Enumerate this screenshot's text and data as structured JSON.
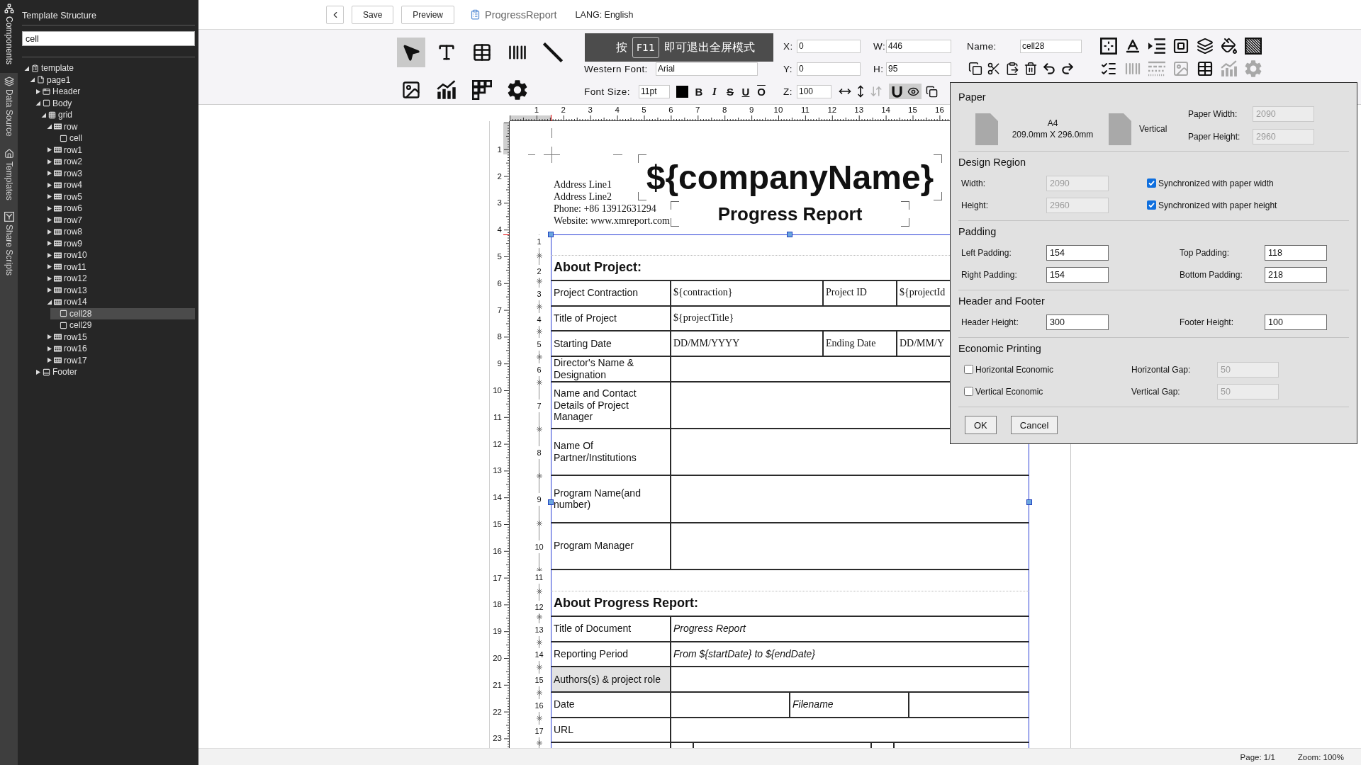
{
  "side_tabs": [
    {
      "label": "Components",
      "kind": "components",
      "selected": true
    },
    {
      "label": "Data Source",
      "kind": "datasource",
      "selected": false
    },
    {
      "label": "Templates",
      "kind": "templates",
      "selected": false
    },
    {
      "label": "Share Scripts",
      "kind": "scripts",
      "selected": false
    }
  ],
  "structure_panel": {
    "title": "Template Structure",
    "search": {
      "value": "cell"
    },
    "tree": [
      {
        "label": "template",
        "kind": "template",
        "expanded": true,
        "selected": false,
        "children": [
          {
            "label": "page1",
            "kind": "page",
            "expanded": true,
            "selected": false,
            "children": [
              {
                "label": "Header",
                "kind": "header",
                "expanded": false,
                "selected": false
              },
              {
                "label": "Body",
                "kind": "body",
                "expanded": true,
                "selected": false,
                "children": [
                  {
                    "label": "grid",
                    "kind": "grid",
                    "expanded": true,
                    "selected": false,
                    "children": [
                      {
                        "label": "row",
                        "kind": "row",
                        "expanded": true,
                        "selected": false,
                        "children": [
                          {
                            "label": "cell",
                            "kind": "cell",
                            "selected": false
                          }
                        ]
                      },
                      {
                        "label": "row1",
                        "kind": "row",
                        "expanded": false,
                        "selected": false
                      },
                      {
                        "label": "row2",
                        "kind": "row",
                        "expanded": false,
                        "selected": false
                      },
                      {
                        "label": "row3",
                        "kind": "row",
                        "expanded": false,
                        "selected": false
                      },
                      {
                        "label": "row4",
                        "kind": "row",
                        "expanded": false,
                        "selected": false
                      },
                      {
                        "label": "row5",
                        "kind": "row",
                        "expanded": false,
                        "selected": false
                      },
                      {
                        "label": "row6",
                        "kind": "row",
                        "expanded": false,
                        "selected": false
                      },
                      {
                        "label": "row7",
                        "kind": "row",
                        "expanded": false,
                        "selected": false
                      },
                      {
                        "label": "row8",
                        "kind": "row",
                        "expanded": false,
                        "selected": false
                      },
                      {
                        "label": "row9",
                        "kind": "row",
                        "expanded": false,
                        "selected": false
                      },
                      {
                        "label": "row10",
                        "kind": "row",
                        "expanded": false,
                        "selected": false
                      },
                      {
                        "label": "row11",
                        "kind": "row",
                        "expanded": false,
                        "selected": false
                      },
                      {
                        "label": "row12",
                        "kind": "row",
                        "expanded": false,
                        "selected": false
                      },
                      {
                        "label": "row13",
                        "kind": "row",
                        "expanded": false,
                        "selected": false
                      },
                      {
                        "label": "row14",
                        "kind": "row",
                        "expanded": true,
                        "selected": false,
                        "children": [
                          {
                            "label": "cell28",
                            "kind": "cell",
                            "selected": true
                          },
                          {
                            "label": "cell29",
                            "kind": "cell",
                            "selected": false
                          }
                        ]
                      },
                      {
                        "label": "row15",
                        "kind": "row",
                        "expanded": false,
                        "selected": false
                      },
                      {
                        "label": "row16",
                        "kind": "row",
                        "expanded": false,
                        "selected": false
                      },
                      {
                        "label": "row17",
                        "kind": "row",
                        "expanded": false,
                        "selected": false
                      }
                    ]
                  }
                ]
              },
              {
                "label": "Footer",
                "kind": "footer",
                "expanded": false,
                "selected": false
              }
            ]
          }
        ]
      }
    ]
  },
  "top_bar": {
    "buttons": [
      "Save",
      "Preview"
    ],
    "document_name": "ProgressReport",
    "language": "LANG: English"
  },
  "toolbar": {
    "tools": [
      {
        "kind": "pointer",
        "selected": true
      },
      {
        "kind": "text",
        "selected": false
      },
      {
        "kind": "table",
        "selected": false
      },
      {
        "kind": "barcode",
        "selected": false
      },
      {
        "kind": "line",
        "selected": false
      },
      {
        "kind": "image",
        "selected": false
      },
      {
        "kind": "chart",
        "selected": false
      },
      {
        "kind": "crosstab",
        "selected": false
      },
      {
        "kind": "settings",
        "selected": false
      }
    ],
    "western_font": {
      "label": "Western Font:",
      "value": "Arial"
    },
    "font_size": {
      "label": "Font Size:",
      "value": "11pt"
    },
    "format_buttons": [
      {
        "label": "B",
        "kind": "bold"
      },
      {
        "label": "I",
        "kind": "italic"
      },
      {
        "label": "S",
        "kind": "strike"
      },
      {
        "label": "U",
        "kind": "underline"
      },
      {
        "label": "O",
        "kind": "overline"
      }
    ],
    "position": [
      {
        "label": "X:",
        "value": "0"
      },
      {
        "label": "W:",
        "value": "446"
      },
      {
        "label": "Y:",
        "value": "0"
      },
      {
        "label": "H:",
        "value": "95"
      }
    ],
    "z_order": {
      "label": "Z:",
      "value": "100"
    },
    "arrange_tools": [
      {
        "kind": "horizontal",
        "disabled": false
      },
      {
        "kind": "vertical",
        "disabled": false
      },
      {
        "kind": "updown",
        "disabled": true
      }
    ],
    "toggles": [
      {
        "kind": "magnet",
        "on": true
      },
      {
        "kind": "eye",
        "on": true
      }
    ],
    "name_field": {
      "label": "Name:",
      "value": "cell28"
    },
    "style_tools": [
      {
        "kind": "border",
        "disabled": false
      },
      {
        "kind": "font",
        "disabled": false
      },
      {
        "kind": "indent",
        "disabled": false
      },
      {
        "kind": "frame",
        "disabled": false
      },
      {
        "kind": "layers",
        "disabled": false
      },
      {
        "kind": "fill",
        "disabled": false
      },
      {
        "kind": "hatch",
        "disabled": false
      },
      {
        "kind": "checklist",
        "disabled": false
      },
      {
        "kind": "barcode",
        "disabled": true
      },
      {
        "kind": "dashes",
        "disabled": true
      },
      {
        "kind": "image",
        "disabled": true
      },
      {
        "kind": "table",
        "disabled": false
      },
      {
        "kind": "chart",
        "disabled": true
      },
      {
        "kind": "settings",
        "disabled": true
      }
    ]
  },
  "fullscreen_hint": {
    "before": "按",
    "key": "F11",
    "after": "即可退出全屏模式"
  },
  "rulers": {
    "horizontal": [
      "1",
      "2",
      "3",
      "4",
      "5",
      "6",
      "7",
      "8",
      "9",
      "10",
      "11",
      "12",
      "13",
      "14",
      "15",
      "16"
    ],
    "vertical": [
      "1",
      "2",
      "3",
      "4",
      "5",
      "6",
      "7",
      "8",
      "9",
      "10",
      "11",
      "12",
      "13",
      "14",
      "15",
      "16",
      "17",
      "18",
      "19",
      "20",
      "21",
      "22",
      "23"
    ]
  },
  "report": {
    "header": {
      "address_lines": [
        "Address Line1",
        "Address Line2",
        "Phone: +86 13912631294",
        "Website: www.xmreport.com"
      ],
      "company_name": "${companyName}",
      "title": "Progress Report"
    },
    "rows": [
      {
        "marker": "1",
        "kind": "spacer"
      },
      {
        "marker": "2",
        "kind": "heading",
        "cells": [
          {
            "kind": "heading",
            "text": "About Project:",
            "selected": false
          }
        ]
      },
      {
        "marker": "3",
        "kind": "quad",
        "cells": [
          {
            "kind": "label",
            "text": "Project Contraction",
            "selected": false
          },
          {
            "kind": "data",
            "text": "${contraction}",
            "selected": false
          },
          {
            "kind": "data",
            "text": "Project ID",
            "selected": false
          },
          {
            "kind": "data",
            "text": "${projectId",
            "selected": false
          }
        ]
      },
      {
        "marker": "4",
        "kind": "pair",
        "cells": [
          {
            "kind": "label",
            "text": "Title of Project",
            "selected": false
          },
          {
            "kind": "data",
            "text": "${projectTitle}",
            "selected": false
          }
        ]
      },
      {
        "marker": "5",
        "kind": "quad",
        "cells": [
          {
            "kind": "label",
            "text": "Starting Date",
            "selected": false
          },
          {
            "kind": "data",
            "text": "DD/MM/YYYY",
            "selected": false
          },
          {
            "kind": "data",
            "text": "Ending Date",
            "selected": false
          },
          {
            "kind": "data",
            "text": "DD/MM/Y",
            "selected": false
          }
        ]
      },
      {
        "marker": "6",
        "kind": "pair",
        "cells": [
          {
            "kind": "label",
            "text": "Director's Name & Designation",
            "selected": false
          },
          {
            "kind": "empty",
            "selected": false
          }
        ]
      },
      {
        "marker": "7",
        "kind": "tall",
        "cells": [
          {
            "kind": "label",
            "text": "Name and Contact Details of Project Manager",
            "selected": false
          },
          {
            "kind": "empty",
            "selected": false
          }
        ]
      },
      {
        "marker": "8",
        "kind": "tall",
        "cells": [
          {
            "kind": "label",
            "text": "Name Of Partner/Institutions",
            "selected": false
          },
          {
            "kind": "empty",
            "selected": false
          }
        ]
      },
      {
        "marker": "9",
        "kind": "tall",
        "cells": [
          {
            "kind": "label",
            "text": "Program Name(and number)",
            "selected": false
          },
          {
            "kind": "empty",
            "selected": false
          }
        ]
      },
      {
        "marker": "10",
        "kind": "tall",
        "cells": [
          {
            "kind": "label",
            "text": "Program Manager",
            "selected": false
          },
          {
            "kind": "empty",
            "selected": false
          }
        ]
      },
      {
        "marker": "11",
        "kind": "spacer"
      },
      {
        "marker": "12",
        "kind": "heading",
        "cells": [
          {
            "kind": "heading",
            "text": "About Progress Report:",
            "selected": false
          }
        ]
      },
      {
        "marker": "13",
        "kind": "pair",
        "cells": [
          {
            "kind": "label",
            "text": "Title of Document",
            "selected": false
          },
          {
            "kind": "note",
            "text": "Progress Report",
            "selected": false
          }
        ]
      },
      {
        "marker": "14",
        "kind": "pair",
        "cells": [
          {
            "kind": "label",
            "text": "Reporting Period",
            "selected": false
          },
          {
            "kind": "note",
            "text": "From ${startDate} to ${endDate}",
            "selected": false
          }
        ]
      },
      {
        "marker": "15",
        "kind": "pair",
        "cells": [
          {
            "kind": "label",
            "text": "Authors(s) & project role",
            "selected": true
          },
          {
            "kind": "empty",
            "selected": false
          }
        ]
      },
      {
        "marker": "16",
        "kind": "even",
        "cells": [
          {
            "kind": "label",
            "text": "Date",
            "selected": false
          },
          {
            "kind": "empty",
            "selected": false
          },
          {
            "kind": "note",
            "text": "Filename",
            "selected": false
          },
          {
            "kind": "empty",
            "selected": false
          }
        ]
      },
      {
        "marker": "17",
        "kind": "pair",
        "cells": [
          {
            "kind": "label",
            "text": "URL",
            "selected": false
          },
          {
            "kind": "empty",
            "selected": false
          }
        ]
      },
      {
        "kind": "split",
        "cells": [
          {
            "kind": "empty",
            "selected": false
          },
          {
            "kind": "empty",
            "selected": false
          },
          {
            "kind": "empty",
            "selected": false
          },
          {
            "kind": "empty",
            "selected": false
          },
          {
            "kind": "empty",
            "selected": false
          }
        ]
      }
    ]
  },
  "page_setup": {
    "paper": {
      "heading": "Paper",
      "size_name": "A4",
      "size_dims": "209.0mm X 296.0mm",
      "orientation": "Vertical",
      "fields": [
        {
          "label": "Paper Width:",
          "value": "2090",
          "disabled": true
        },
        {
          "label": "Paper Height:",
          "value": "2960",
          "disabled": true
        }
      ]
    },
    "design_region": {
      "heading": "Design Region",
      "rows": [
        {
          "field": {
            "label": "Width:",
            "value": "2090",
            "disabled": true
          },
          "checkbox": {
            "label": "Synchronized with paper width",
            "checked": true
          }
        },
        {
          "field": {
            "label": "Height:",
            "value": "2960",
            "disabled": true
          },
          "checkbox": {
            "label": "Synchronized with paper height",
            "checked": true
          }
        }
      ]
    },
    "padding": {
      "heading": "Padding",
      "rows": [
        {
          "left": {
            "label": "Left Padding:",
            "value": "154",
            "disabled": false
          },
          "right": {
            "label": "Top Padding:",
            "value": "118",
            "disabled": false
          }
        },
        {
          "left": {
            "label": "Right Padding:",
            "value": "154",
            "disabled": false
          },
          "right": {
            "label": "Bottom Padding:",
            "value": "218",
            "disabled": false
          }
        }
      ]
    },
    "header_footer": {
      "heading": "Header and Footer",
      "rows": [
        {
          "left": {
            "label": "Header Height:",
            "value": "300",
            "disabled": false
          },
          "right": {
            "label": "Footer Height:",
            "value": "100",
            "disabled": false
          }
        }
      ]
    },
    "economic_printing": {
      "heading": "Economic Printing",
      "rows": [
        {
          "checkbox": {
            "label": "Horizontal Economic",
            "checked": false
          },
          "field": {
            "label": "Horizontal Gap:",
            "value": "50",
            "disabled": true
          }
        },
        {
          "checkbox": {
            "label": "Vertical Economic",
            "checked": false
          },
          "field": {
            "label": "Vertical Gap:",
            "value": "50",
            "disabled": true
          }
        }
      ]
    },
    "buttons": [
      "OK",
      "Cancel"
    ]
  },
  "status_bar": {
    "page": "Page: 1/1",
    "zoom": "Zoom: 100%"
  }
}
